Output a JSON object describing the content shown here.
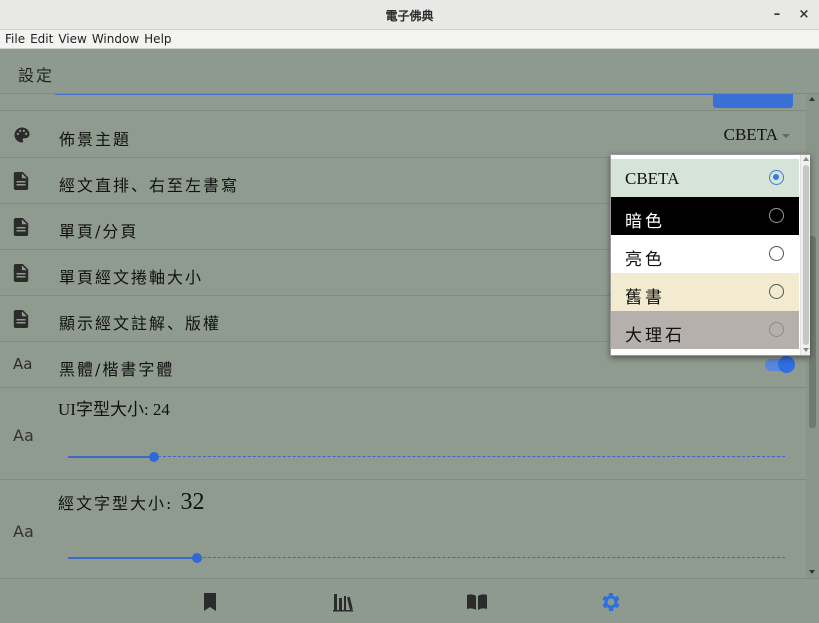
{
  "window": {
    "title": "電子佛典",
    "minimize_label": "–",
    "close_label": "×"
  },
  "menubar": {
    "items": [
      "File",
      "Edit",
      "View",
      "Window",
      "Help"
    ]
  },
  "appbar": {
    "title": "設定"
  },
  "settings": {
    "theme": {
      "label": "佈景主題",
      "value": "CBETA",
      "icon": "palette-icon"
    },
    "vertical": {
      "label": "經文直排、右至左書寫",
      "icon": "document-icon"
    },
    "paging": {
      "label": "單頁/分頁",
      "icon": "document-icon"
    },
    "scroll_size": {
      "label": "單頁經文捲軸大小",
      "icon": "document-icon"
    },
    "notes": {
      "label": "顯示經文註解、版權",
      "icon": "document-icon"
    },
    "font_style": {
      "label": "黑體/楷書字體",
      "icon_text": "Aa",
      "toggle_on": true
    },
    "ui_font": {
      "label": "UI字型大小: 24",
      "icon_text": "Aa",
      "slider_fraction": 0.12
    },
    "sutra_font": {
      "label_prefix": "經文字型大小: ",
      "label_value": "32",
      "icon_text": "Aa",
      "slider_fraction": 0.18
    }
  },
  "theme_dropdown": {
    "options": [
      {
        "label": "CBETA",
        "selected": true,
        "bg": "#d6e4d8",
        "fg": "#111111",
        "font": "latin"
      },
      {
        "label": "暗色",
        "selected": false,
        "bg": "#000000",
        "fg": "#ffffff",
        "font": "cjk"
      },
      {
        "label": "亮色",
        "selected": false,
        "bg": "#ffffff",
        "fg": "#111111",
        "font": "cjk"
      },
      {
        "label": "舊書",
        "selected": false,
        "bg": "#f2ebcf",
        "fg": "#111111",
        "font": "cjk"
      },
      {
        "label": "大理石",
        "selected": false,
        "bg": "#b5b0ac",
        "fg": "#111111",
        "font": "cjk"
      }
    ]
  },
  "bottom_nav": {
    "items": [
      {
        "name": "bookmark-icon",
        "active": false
      },
      {
        "name": "library-icon",
        "active": false
      },
      {
        "name": "book-icon",
        "active": false
      },
      {
        "name": "settings-gear-icon",
        "active": true
      }
    ]
  },
  "colors": {
    "accent": "#3068d8",
    "background": "#8f9a8f"
  }
}
